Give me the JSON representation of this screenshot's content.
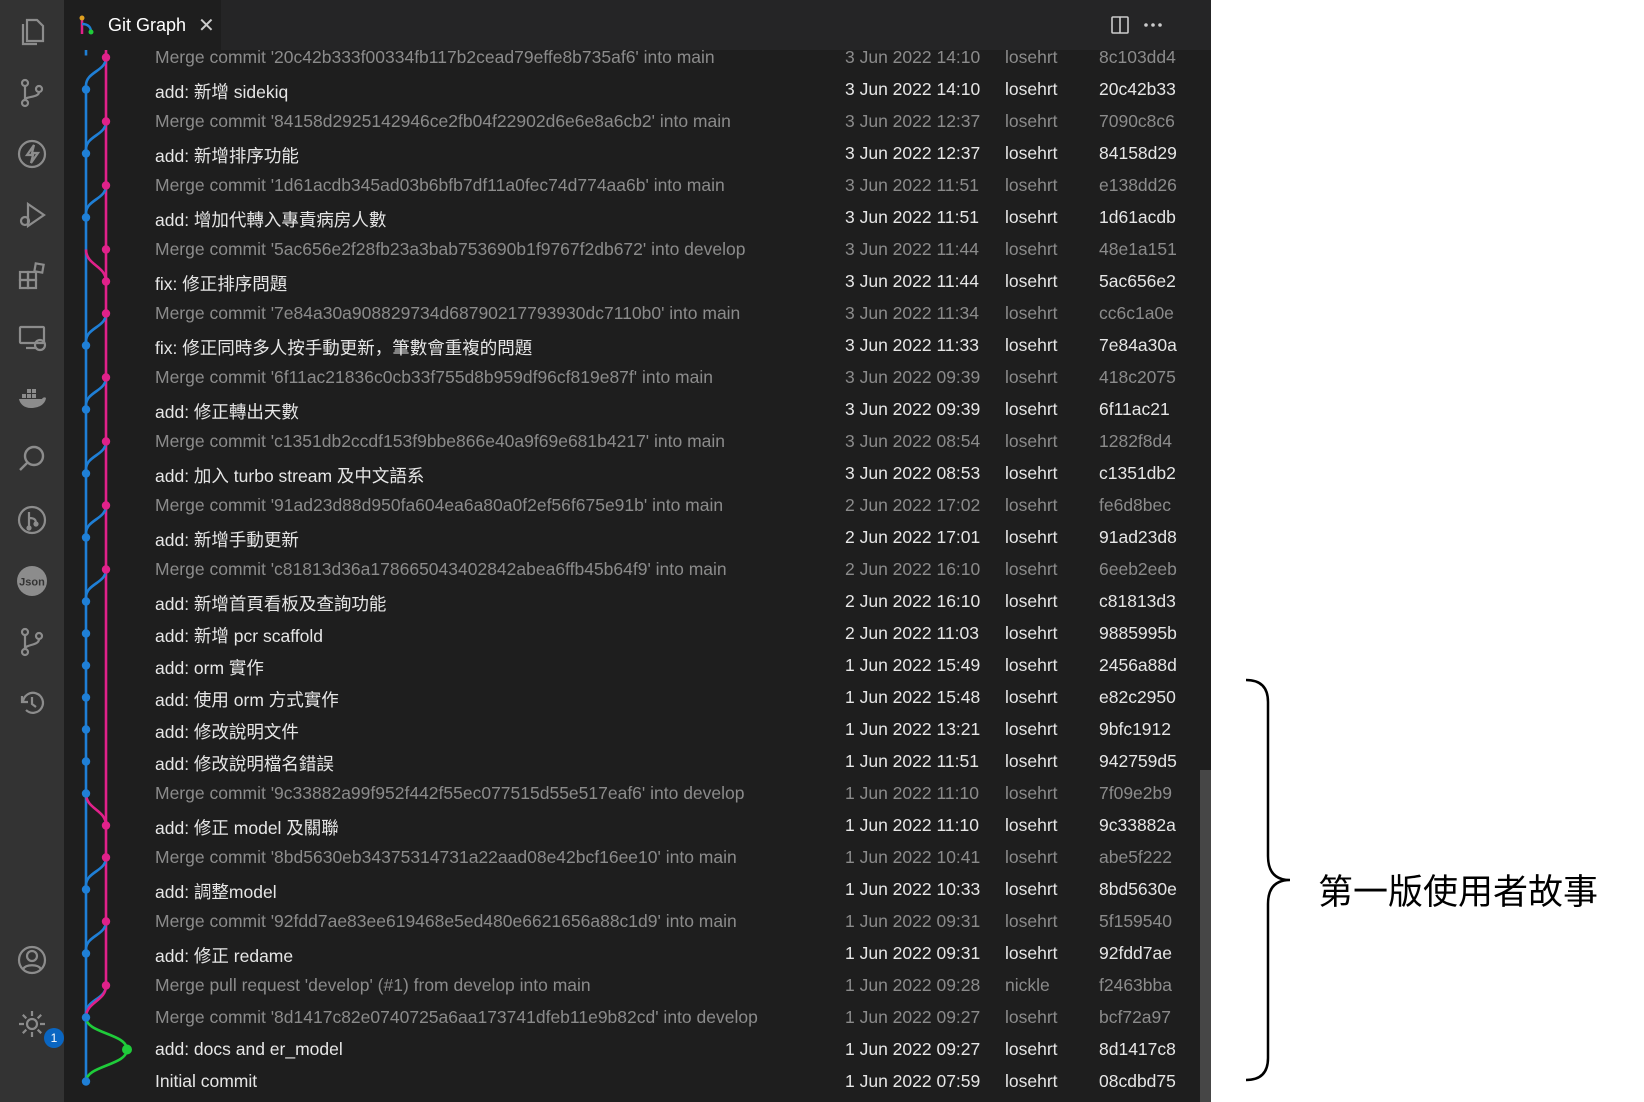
{
  "tab": {
    "title": "Git Graph",
    "close": "✕"
  },
  "sidebar_icons": [
    "files-icon",
    "source-control-icon",
    "lightning-icon",
    "run-debug-icon",
    "extensions-icon",
    "remote-explorer-icon",
    "docker-icon",
    "search-icon",
    "git-graph-icon",
    "json-icon",
    "branch-icon",
    "history-icon",
    "account-icon",
    "settings-icon"
  ],
  "sidebar": {
    "json_label": "Json",
    "settings_badge": "1"
  },
  "colors": {
    "main_branch": "#1f7fd6",
    "develop_branch": "#e0218a",
    "feature_branch": "#1fcc3a",
    "editor_bg": "#1e1e1e",
    "activity_bg": "#333333"
  },
  "commits": [
    {
      "message": "Merge commit '20c42b333f00334fb117b2cead79effe8b735af6' into main",
      "date": "3 Jun 2022 14:10",
      "author": "losehrt",
      "hash": "8c103dd4",
      "merge": true
    },
    {
      "message": "add: 新增 sidekiq",
      "date": "3 Jun 2022 14:10",
      "author": "losehrt",
      "hash": "20c42b33",
      "merge": false
    },
    {
      "message": "Merge commit '84158d2925142946ce2fb04f22902d6e6e8a6cb2' into main",
      "date": "3 Jun 2022 12:37",
      "author": "losehrt",
      "hash": "7090c8c6",
      "merge": true
    },
    {
      "message": "add: 新增排序功能",
      "date": "3 Jun 2022 12:37",
      "author": "losehrt",
      "hash": "84158d29",
      "merge": false
    },
    {
      "message": "Merge commit '1d61acdb345ad03b6bfb7df11a0fec74d774aa6b' into main",
      "date": "3 Jun 2022 11:51",
      "author": "losehrt",
      "hash": "e138dd26",
      "merge": true
    },
    {
      "message": "add: 增加代轉入專責病房人數",
      "date": "3 Jun 2022 11:51",
      "author": "losehrt",
      "hash": "1d61acdb",
      "merge": false
    },
    {
      "message": "Merge commit '5ac656e2f28fb23a3bab753690b1f9767f2db672' into develop",
      "date": "3 Jun 2022 11:44",
      "author": "losehrt",
      "hash": "48e1a151",
      "merge": true
    },
    {
      "message": "fix: 修正排序問題",
      "date": "3 Jun 2022 11:44",
      "author": "losehrt",
      "hash": "5ac656e2",
      "merge": false
    },
    {
      "message": "Merge commit '7e84a30a908829734d68790217793930dc7110b0' into main",
      "date": "3 Jun 2022 11:34",
      "author": "losehrt",
      "hash": "cc6c1a0e",
      "merge": true
    },
    {
      "message": "fix: 修正同時多人按手動更新，筆數會重複的問題",
      "date": "3 Jun 2022 11:33",
      "author": "losehrt",
      "hash": "7e84a30a",
      "merge": false
    },
    {
      "message": "Merge commit '6f11ac21836c0cb33f755d8b959df96cf819e87f' into main",
      "date": "3 Jun 2022 09:39",
      "author": "losehrt",
      "hash": "418c2075",
      "merge": true
    },
    {
      "message": "add: 修正轉出天數",
      "date": "3 Jun 2022 09:39",
      "author": "losehrt",
      "hash": "6f11ac21",
      "merge": false
    },
    {
      "message": "Merge commit 'c1351db2ccdf153f9bbe866e40a9f69e681b4217' into main",
      "date": "3 Jun 2022 08:54",
      "author": "losehrt",
      "hash": "1282f8d4",
      "merge": true
    },
    {
      "message": "add: 加入 turbo stream 及中文語系",
      "date": "3 Jun 2022 08:53",
      "author": "losehrt",
      "hash": "c1351db2",
      "merge": false
    },
    {
      "message": "Merge commit '91ad23d88d950fa604ea6a80a0f2ef56f675e91b' into main",
      "date": "2 Jun 2022 17:02",
      "author": "losehrt",
      "hash": "fe6d8bec",
      "merge": true
    },
    {
      "message": "add: 新增手動更新",
      "date": "2 Jun 2022 17:01",
      "author": "losehrt",
      "hash": "91ad23d8",
      "merge": false
    },
    {
      "message": "Merge commit 'c81813d36a178665043402842abea6ffb45b64f9' into main",
      "date": "2 Jun 2022 16:10",
      "author": "losehrt",
      "hash": "6eeb2eeb",
      "merge": true
    },
    {
      "message": "add: 新增首頁看板及查詢功能",
      "date": "2 Jun 2022 16:10",
      "author": "losehrt",
      "hash": "c81813d3",
      "merge": false
    },
    {
      "message": "add: 新增 pcr scaffold",
      "date": "2 Jun 2022 11:03",
      "author": "losehrt",
      "hash": "9885995b",
      "merge": false
    },
    {
      "message": "add: orm 實作",
      "date": "1 Jun 2022 15:49",
      "author": "losehrt",
      "hash": "2456a88d",
      "merge": false
    },
    {
      "message": "add: 使用 orm 方式實作",
      "date": "1 Jun 2022 15:48",
      "author": "losehrt",
      "hash": "e82c2950",
      "merge": false
    },
    {
      "message": "add: 修改說明文件",
      "date": "1 Jun 2022 13:21",
      "author": "losehrt",
      "hash": "9bfc1912",
      "merge": false
    },
    {
      "message": "add: 修改說明檔名錯誤",
      "date": "1 Jun 2022 11:51",
      "author": "losehrt",
      "hash": "942759d5",
      "merge": false
    },
    {
      "message": "Merge commit '9c33882a99f952f442f55ec077515d55e517eaf6' into develop",
      "date": "1 Jun 2022 11:10",
      "author": "losehrt",
      "hash": "7f09e2b9",
      "merge": true
    },
    {
      "message": "add: 修正 model 及關聯",
      "date": "1 Jun 2022 11:10",
      "author": "losehrt",
      "hash": "9c33882a",
      "merge": false
    },
    {
      "message": "Merge commit '8bd5630eb34375314731a22aad08e42bcf16ee10' into main",
      "date": "1 Jun 2022 10:41",
      "author": "losehrt",
      "hash": "abe5f222",
      "merge": true
    },
    {
      "message": "add: 調整model",
      "date": "1 Jun 2022 10:33",
      "author": "losehrt",
      "hash": "8bd5630e",
      "merge": false
    },
    {
      "message": "Merge commit '92fdd7ae83ee619468e5ed480e6621656a88c1d9' into main",
      "date": "1 Jun 2022 09:31",
      "author": "losehrt",
      "hash": "5f159540",
      "merge": true
    },
    {
      "message": "add: 修正 redame",
      "date": "1 Jun 2022 09:31",
      "author": "losehrt",
      "hash": "92fdd7ae",
      "merge": false
    },
    {
      "message": "Merge pull request 'develop' (#1) from develop into main",
      "date": "1 Jun 2022 09:28",
      "author": "nickle",
      "hash": "f2463bba",
      "merge": true
    },
    {
      "message": "Merge commit '8d1417c82e0740725a6aa173741dfeb11e9b82cd' into develop",
      "date": "1 Jun 2022 09:27",
      "author": "losehrt",
      "hash": "bcf72a97",
      "merge": true
    },
    {
      "message": "add: docs and er_model",
      "date": "1 Jun 2022 09:27",
      "author": "losehrt",
      "hash": "8d1417c8",
      "merge": false
    },
    {
      "message": "Initial commit",
      "date": "1 Jun 2022 07:59",
      "author": "losehrt",
      "hash": "08cdbd75",
      "merge": false
    }
  ],
  "graph_lanes": [
    "pink",
    "blue",
    "pink",
    "blue",
    "pink",
    "blue",
    "pink",
    "pink",
    "pink",
    "blue",
    "pink",
    "blue",
    "pink",
    "blue",
    "pink",
    "blue",
    "pink",
    "blue",
    "blue",
    "blue",
    "blue",
    "blue",
    "blue",
    "blue",
    "pink",
    "pink",
    "blue",
    "pink",
    "blue",
    "pink",
    "blue",
    "green",
    "blue"
  ],
  "annotation": {
    "label": "第一版使用者故事"
  }
}
